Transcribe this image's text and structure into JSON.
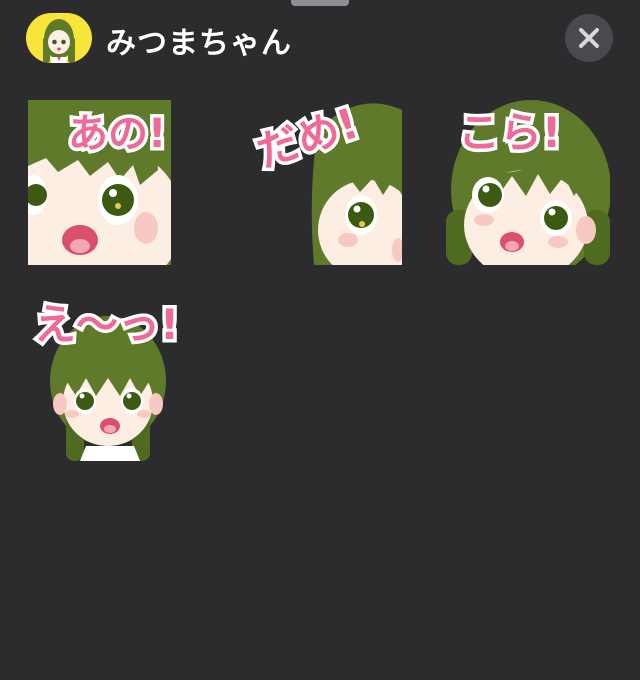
{
  "sheet": {
    "title": "みつまちゃん",
    "avatar_icon": "girl-avatar-icon",
    "close_icon": "close-icon"
  },
  "stickers": [
    {
      "caption": "あの!",
      "description": "girl-surprised-closeup"
    },
    {
      "caption": "だめ!",
      "description": "girl-peeking-side"
    },
    {
      "caption": "こら!",
      "description": "girl-tilted-head"
    },
    {
      "caption": "え〜っ!",
      "description": "girl-shocked-full"
    }
  ],
  "colors": {
    "background": "#2c2c2e",
    "caption_pink": "#f06a98",
    "hair_green": "#5e7a2a",
    "skin": "#fdeee4",
    "avatar_yellow": "#f7e53a"
  }
}
